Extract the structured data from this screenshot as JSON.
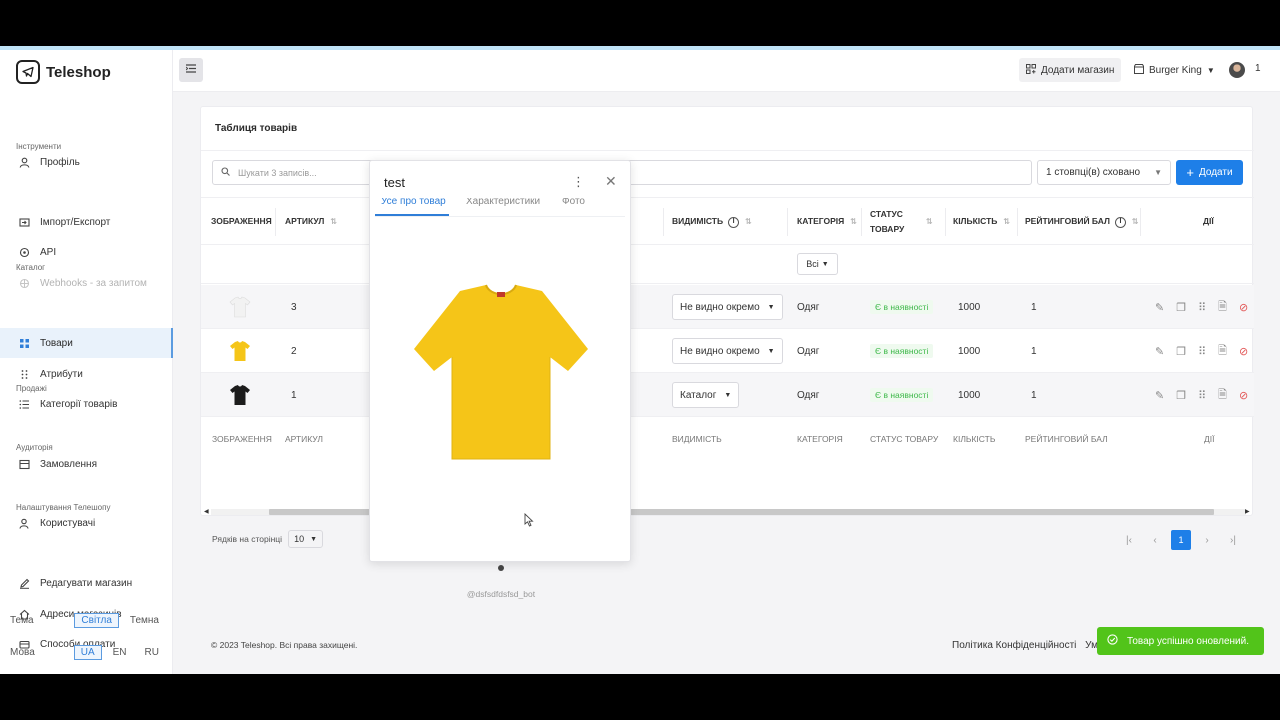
{
  "app": {
    "name": "Teleshop"
  },
  "sidebar": {
    "items": [
      {
        "label": "Профіль",
        "icon": "user-icon"
      },
      {
        "label": "Імпорт/Експорт",
        "icon": "import-export-icon"
      },
      {
        "label": "API",
        "icon": "api-icon"
      },
      {
        "label": "Webhooks - за запитом",
        "icon": "webhook-icon"
      },
      {
        "label": "Товари",
        "icon": "grid-icon"
      },
      {
        "label": "Атрибути",
        "icon": "attributes-icon"
      },
      {
        "label": "Категорії товарів",
        "icon": "list-icon"
      },
      {
        "label": "Замовлення",
        "icon": "orders-icon"
      },
      {
        "label": "Користувачі",
        "icon": "users-icon"
      },
      {
        "label": "Редагувати магазин",
        "icon": "edit-icon"
      },
      {
        "label": "Адреси магазинів",
        "icon": "home-icon"
      },
      {
        "label": "Способи оплати",
        "icon": "payment-icon"
      }
    ],
    "sections": [
      "Інструменти",
      "Каталог",
      "Продажі",
      "Аудиторія",
      "Налаштування Телешопу"
    ],
    "theme_label": "Тема",
    "theme_options": [
      "Світла",
      "Темна"
    ],
    "lang_label": "Мова",
    "lang_options": [
      "UA",
      "EN",
      "RU"
    ]
  },
  "topbar": {
    "add_shop": "Додати магазин",
    "shop_name": "Burger King",
    "notifications": "1"
  },
  "card": {
    "title": "Таблиця товарів",
    "search_placeholder": "Шукати 3 записів...",
    "columns_hidden": "1 стовпці(в) сховано",
    "add_label": "Додати"
  },
  "table": {
    "headers": [
      "Зображення",
      "Артикул",
      "Видимість",
      "Категорія",
      "Статус товару",
      "Кількість",
      "Рейтинговий бал",
      "Дії"
    ],
    "filter_value": "Всі",
    "rows": [
      {
        "sku": "3",
        "visibility": "Не видно окремо",
        "category": "Одяг",
        "status": "Є в наявності",
        "qty": "1000",
        "rating": "1",
        "color": "#f2f2f2"
      },
      {
        "sku": "2",
        "visibility": "Не видно окремо",
        "category": "Одяг",
        "status": "Є в наявності",
        "qty": "1000",
        "rating": "1",
        "color": "#f5c518"
      },
      {
        "sku": "1",
        "visibility": "Каталог",
        "category": "Одяг",
        "status": "Є в наявності",
        "qty": "1000",
        "rating": "1",
        "color": "#1c1c1c"
      }
    ]
  },
  "pagination": {
    "rows_per_page_label": "Рядків на сторінці",
    "rows_per_page": "10",
    "current_page": "1"
  },
  "footer": {
    "copyright": "© 2023 Teleshop. Всі права захищені.",
    "privacy": "Політика Конфіденційності",
    "terms": "Умо"
  },
  "toast": {
    "message": "Товар успішно оновлений."
  },
  "modal": {
    "title": "test",
    "tabs": [
      "Усе про товар",
      "Характеристики",
      "Фото"
    ],
    "bot": "@dsfsdfdsfsd_bot",
    "shirt_color": "#f5c518"
  }
}
